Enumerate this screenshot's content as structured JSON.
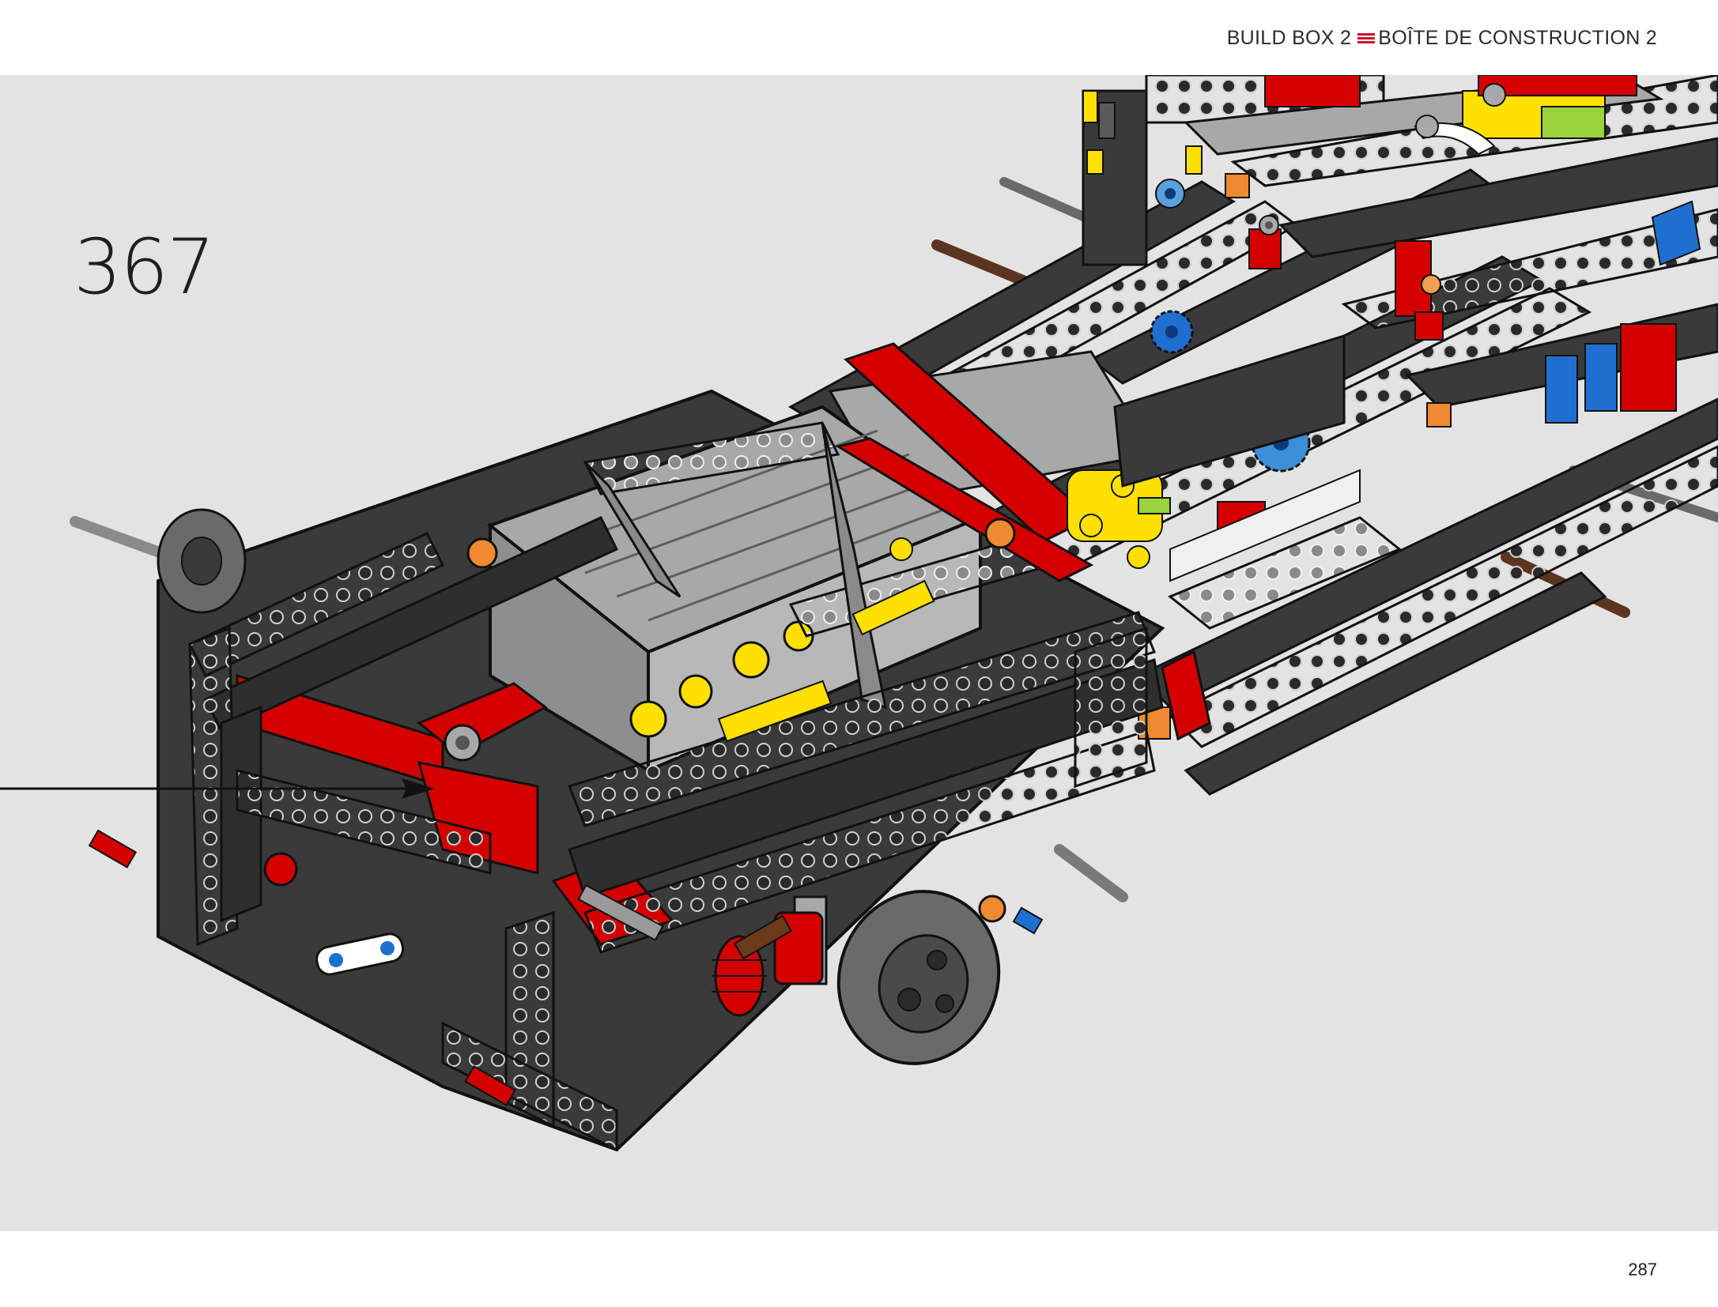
{
  "header": {
    "build_box_en": "BUILD BOX 2",
    "build_box_fr": "BOÎTE DE CONSTRUCTION 2",
    "separator_icon": "triple-bar-icon",
    "separator_color": "#c8102e"
  },
  "step": {
    "number": "367"
  },
  "footer": {
    "page_number": "287"
  },
  "colors": {
    "background": "#e3e3e3",
    "dark_gray": "#3a3a3a",
    "light_gray": "#a8a8a8",
    "red": "#d40000",
    "yellow": "#ffe000",
    "blue": "#1f6fd0",
    "orange": "#f08a30",
    "brown": "#6a3a1a"
  },
  "callout": {
    "icon": "arrow-right-icon"
  }
}
